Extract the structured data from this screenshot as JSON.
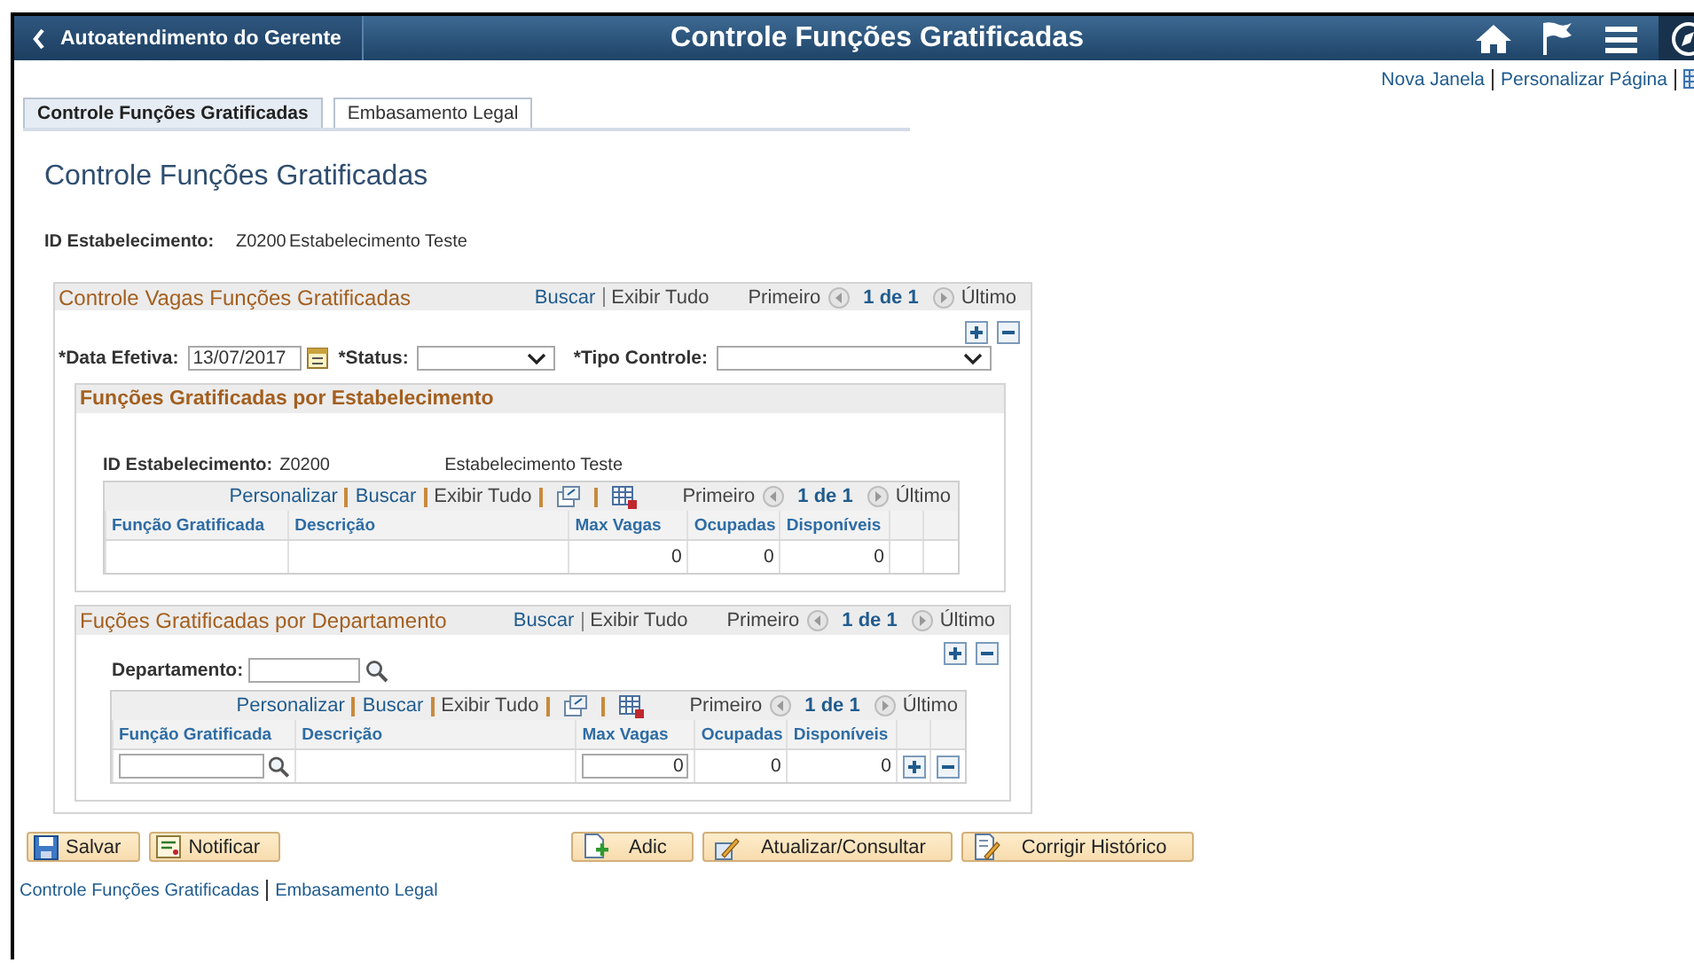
{
  "header": {
    "back_label": "Autoatendimento do Gerente",
    "title": "Controle Funções Gratificadas"
  },
  "top_links": [
    "Nova Janela",
    "Personalizar Página"
  ],
  "tabs": [
    {
      "label": "Controle Funções Gratificadas",
      "selected": true
    },
    {
      "label": "Embasamento Legal",
      "selected": false
    }
  ],
  "page_title": "Controle Funções Gratificadas",
  "establishment": {
    "label": "ID Estabelecimento:",
    "code": "Z0200",
    "name": "Estabelecimento Teste"
  },
  "vacancy_section": {
    "title": "Controle Vagas Funções Gratificadas",
    "nav": {
      "find": "Buscar",
      "view_all": "Exibir Tudo",
      "first": "Primeiro",
      "count": "1 de 1",
      "last": "Último"
    },
    "fields": [
      {
        "kind": "date",
        "label": "*Data Efetiva:",
        "value": "13/07/2017"
      },
      {
        "kind": "select",
        "label": "*Status:"
      },
      {
        "kind": "select",
        "label": "*Tipo Controle:"
      }
    ],
    "establishment_block": {
      "title": "Funções Gratificadas por Estabelecimento",
      "id_label": "ID Estabelecimento:",
      "code": "Z0200",
      "name": "Estabelecimento Teste",
      "grid": {
        "nav": {
          "personalize": "Personalizar",
          "find": "Buscar",
          "view_all": "Exibir Tudo",
          "first": "Primeiro",
          "count": "1 de 1",
          "last": "Último"
        },
        "columns": [
          "Função Gratificada",
          "Descrição",
          "Max Vagas",
          "Ocupadas",
          "Disponíveis"
        ],
        "rows": [
          {
            "kind": "display",
            "max_vagas": "0",
            "ocupadas": "0",
            "disponiveis": "0"
          }
        ]
      }
    },
    "department_block": {
      "title": "Fuções Gratificadas por Departamento",
      "nav": {
        "find": "Buscar",
        "view_all": "Exibir Tudo",
        "first": "Primeiro",
        "count": "1 de 1",
        "last": "Último"
      },
      "field_label": "Departamento:",
      "grid": {
        "nav": {
          "personalize": "Personalizar",
          "find": "Buscar",
          "view_all": "Exibir Tudo",
          "first": "Primeiro",
          "count": "1 de 1",
          "last": "Último"
        },
        "columns": [
          "Função Gratificada",
          "Descrição",
          "Max Vagas",
          "Ocupadas",
          "Disponíveis"
        ],
        "rows": [
          {
            "kind": "edit",
            "max_vagas": "0",
            "ocupadas": "0",
            "disponiveis": "0"
          }
        ]
      }
    }
  },
  "buttons_left": [
    {
      "kind": "save",
      "label": "Salvar"
    },
    {
      "kind": "notify",
      "label": "Notificar"
    }
  ],
  "buttons_right": [
    {
      "kind": "add",
      "label": "Adic"
    },
    {
      "kind": "update",
      "label": "Atualizar/Consultar"
    },
    {
      "kind": "correct",
      "label": "Corrigir Histórico"
    }
  ],
  "footer_links": [
    "Controle Funções Gratificadas",
    "Embasamento Legal"
  ]
}
